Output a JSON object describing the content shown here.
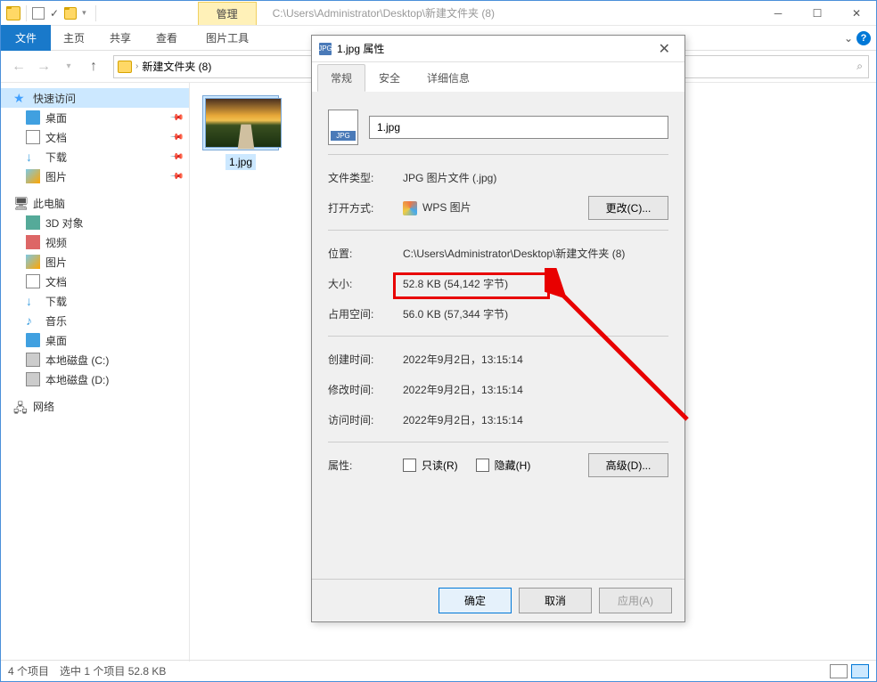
{
  "titlebar": {
    "manage_label": "管理",
    "path": "C:\\Users\\Administrator\\Desktop\\新建文件夹 (8)"
  },
  "ribbon": {
    "file": "文件",
    "home": "主页",
    "share": "共享",
    "view": "查看",
    "pic_tools": "图片工具"
  },
  "breadcrumb": {
    "folder": "新建文件夹 (8)"
  },
  "sidebar": {
    "quick": "快速访问",
    "desktop": "桌面",
    "docs": "文档",
    "downloads": "下载",
    "pictures": "图片",
    "thispc": "此电脑",
    "threed": "3D 对象",
    "video": "视频",
    "pictures2": "图片",
    "docs2": "文档",
    "downloads2": "下载",
    "music": "音乐",
    "desktop2": "桌面",
    "diskc": "本地磁盘 (C:)",
    "diskd": "本地磁盘 (D:)",
    "network": "网络"
  },
  "file": {
    "name": "1.jpg"
  },
  "statusbar": {
    "count": "4 个项目",
    "selection": "选中 1 个项目  52.8 KB"
  },
  "dialog": {
    "title": "1.jpg 属性",
    "tabs": {
      "general": "常规",
      "security": "安全",
      "details": "详细信息"
    },
    "filename": "1.jpg",
    "type_label": "文件类型:",
    "type_val": "JPG 图片文件 (.jpg)",
    "open_label": "打开方式:",
    "open_val": "WPS 图片",
    "change_btn": "更改(C)...",
    "loc_label": "位置:",
    "loc_val": "C:\\Users\\Administrator\\Desktop\\新建文件夹 (8)",
    "size_label": "大小:",
    "size_val": "52.8 KB (54,142 字节)",
    "disk_label": "占用空间:",
    "disk_val": "56.0 KB (57,344 字节)",
    "created_label": "创建时间:",
    "created_val": "2022年9月2日，13:15:14",
    "modified_label": "修改时间:",
    "modified_val": "2022年9月2日，13:15:14",
    "accessed_label": "访问时间:",
    "accessed_val": "2022年9月2日，13:15:14",
    "attr_label": "属性:",
    "readonly": "只读(R)",
    "hidden": "隐藏(H)",
    "advanced_btn": "高级(D)...",
    "ok": "确定",
    "cancel": "取消",
    "apply": "应用(A)"
  }
}
